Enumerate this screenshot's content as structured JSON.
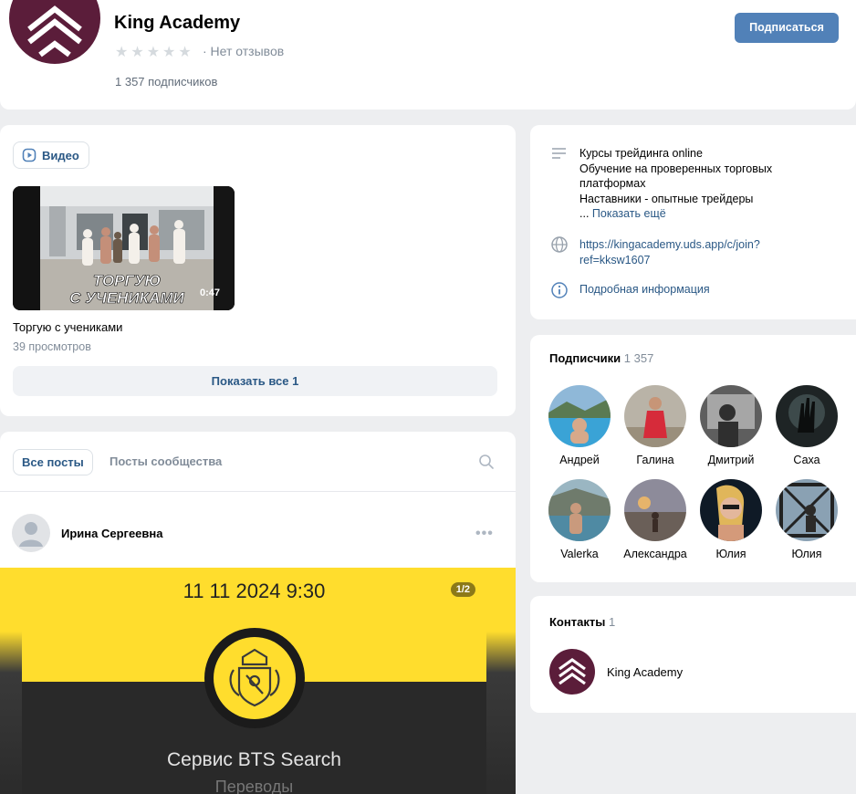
{
  "header": {
    "title": "King Academy",
    "stars": "★★★★★",
    "reviews": "· Нет отзывов",
    "subscribers": "1 357 подписчиков",
    "subscribe_label": "Подписаться"
  },
  "video": {
    "section_label": "Видео",
    "thumb_text_1": "ТОРГУЮ",
    "thumb_text_2": "С УЧЕНИКАМИ",
    "duration": "0:47",
    "title": "Торгую с учениками",
    "views": "39 просмотров",
    "show_all": "Показать все 1"
  },
  "posts": {
    "tab_all": "Все посты",
    "tab_community": "Посты сообщества",
    "author": "Ирина Сергеевна",
    "more": "•••",
    "image": {
      "date": "11 11 2024 9:30",
      "counter": "1/2",
      "service": "Сервис BTS Search",
      "subtitle": "Переводы"
    }
  },
  "info": {
    "desc_lines": [
      "Курсы трейдинга online",
      "Обучение на проверенных торговых",
      "платформах",
      "Наставники - опытные трейдеры"
    ],
    "ellipsis": "... ",
    "show_more": "Показать ещё",
    "url_1": "https://kingacademy.uds.app/c/join?",
    "url_2": "ref=kksw1607",
    "details": "Подробная информация"
  },
  "subscribers": {
    "title": "Подписчики",
    "count": "1 357",
    "items": [
      {
        "name": "Андрей"
      },
      {
        "name": "Галина"
      },
      {
        "name": "Дмитрий"
      },
      {
        "name": "Саха"
      },
      {
        "name": "Valerka"
      },
      {
        "name": "Александра"
      },
      {
        "name": "Юлия"
      },
      {
        "name": "Юлия"
      }
    ]
  },
  "contacts": {
    "title": "Контакты",
    "count": "1",
    "name": "King Academy"
  },
  "colors": {
    "brand": "#5b1d3a",
    "accent": "#5181b8",
    "link": "#2a5885",
    "tinkoff_yellow": "#ffdd2d"
  },
  "icons": [
    "chevrons-logo-icon",
    "video-play-icon",
    "search-icon",
    "lines-icon",
    "globe-icon",
    "info-icon",
    "default-avatar-icon",
    "coat-of-arms-icon"
  ]
}
